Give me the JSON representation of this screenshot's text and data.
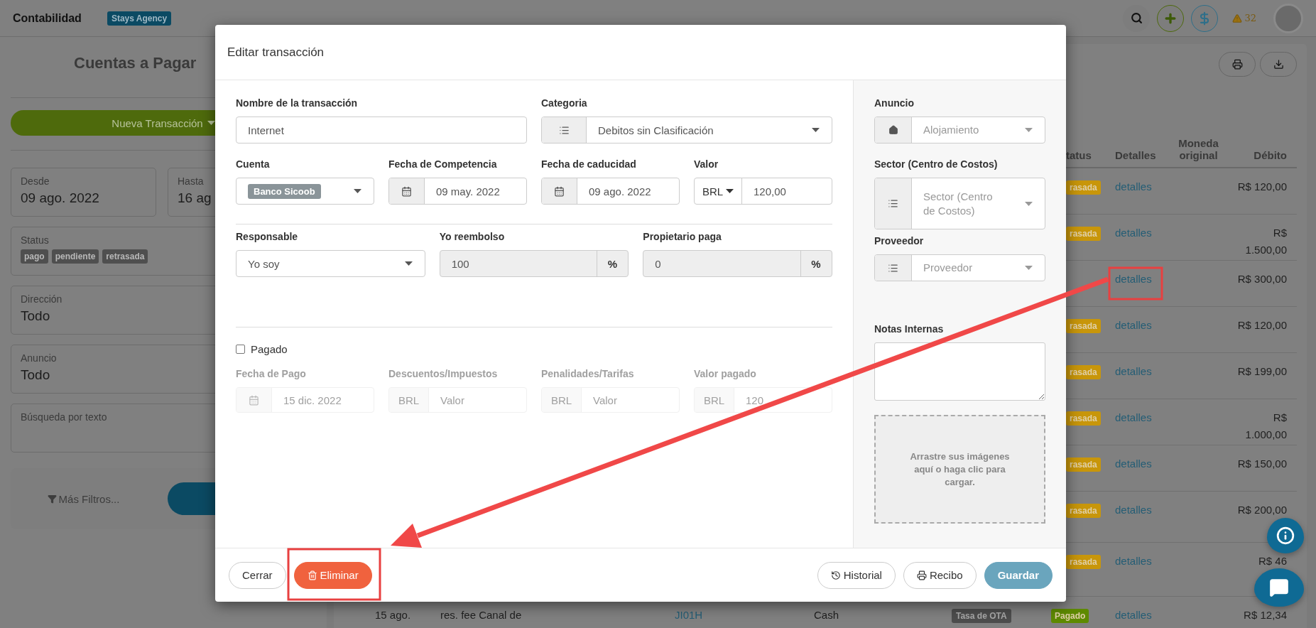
{
  "topbar": {
    "title": "Contabilidad",
    "account_badge": "Stays Agency",
    "alerts": "32"
  },
  "sidebar": {
    "title": "Cuentas a Pagar",
    "new_button": "Nueva Transacción",
    "date_range": [
      {
        "label": "Desde",
        "value": "09 ago. 2022"
      },
      {
        "label": "Hasta",
        "value": "16 ag"
      }
    ],
    "status_filter": {
      "label": "Status",
      "tags": [
        "pago",
        "pendiente",
        "retrasada"
      ]
    },
    "selects": [
      {
        "label": "Dirección",
        "value": "Todo"
      },
      {
        "label": "Anuncio",
        "value": "Todo"
      }
    ],
    "text_search": {
      "label": "Búsqueda por texto"
    },
    "more_filters": "Más Filtros..."
  },
  "table": {
    "columns": [
      {
        "kind": "status",
        "label": "tatus"
      },
      {
        "kind": "details",
        "label": "Detalles"
      },
      {
        "kind": "currency",
        "label": "Moneda original"
      },
      {
        "kind": "debit",
        "label": "Débito"
      }
    ],
    "rows": [
      {
        "kind": "partial",
        "status": {
          "text": "rasada",
          "color": "#c8960a"
        },
        "details": "detalles",
        "debit": "R$ 120,00"
      },
      {
        "kind": "partial",
        "status": {
          "text": "rasada",
          "color": "#c8960a"
        },
        "details": "detalles",
        "debit": "R$ 1.500,00"
      },
      {
        "kind": "partial",
        "details": "detalles",
        "debit": "R$ 300,00"
      },
      {
        "kind": "partial",
        "status": {
          "text": "rasada",
          "color": "#c8960a"
        },
        "details": "detalles",
        "debit": "R$ 120,00"
      },
      {
        "kind": "partial",
        "status": {
          "text": "rasada",
          "color": "#c8960a"
        },
        "details": "detalles",
        "debit": "R$ 199,00"
      },
      {
        "kind": "partial",
        "status": {
          "text": "rasada",
          "color": "#c8960a"
        },
        "details": "detalles",
        "debit": "R$ 1.000,00"
      },
      {
        "kind": "partial",
        "status": {
          "text": "rasada",
          "color": "#c8960a"
        },
        "details": "detalles",
        "debit": "R$ 150,00"
      },
      {
        "kind": "partial",
        "status": {
          "text": "rasada",
          "color": "#c8960a"
        },
        "details": "detalles",
        "debit": "R$ 200,00"
      },
      {
        "kind": "partial",
        "status": {
          "text": "rasada",
          "color": "#c8960a"
        },
        "details": "detalles",
        "debit": "R$ 46"
      },
      {
        "kind": "full",
        "date": "15 ago.",
        "description": "res. fee Canal de",
        "code": "JI01H",
        "method": "Cash",
        "tag": "Tasa de OTA",
        "status": {
          "text": "Pagado",
          "color": "#5e8a00"
        },
        "details": "detalles",
        "debit": "R$ 12,34"
      }
    ]
  },
  "modal": {
    "title": "Editar transacción",
    "name_field": {
      "label": "Nombre de la transacción",
      "value": "Internet"
    },
    "category": {
      "label": "Categoria",
      "value": "Debitos sin Clasificación"
    },
    "account": {
      "label": "Cuenta",
      "value": "Banco Sicoob"
    },
    "competence_date": {
      "label": "Fecha de Competencia",
      "value": "09 may. 2022"
    },
    "due_date": {
      "label": "Fecha de caducidad",
      "value": "09 ago. 2022"
    },
    "amount": {
      "label": "Valor",
      "currency": "BRL",
      "value": "120,00"
    },
    "responsible": {
      "label": "Responsable",
      "value": "Yo soy"
    },
    "shares": [
      {
        "label": "Yo reembolso",
        "value": "100",
        "unit": "%"
      },
      {
        "label": "Propietario paga",
        "value": "0",
        "unit": "%"
      }
    ],
    "paid": {
      "label": "Pagado",
      "checked": false
    },
    "payment": {
      "disabled": true,
      "fields": [
        {
          "kind": "date",
          "label": "Fecha de Pago",
          "value": "15 dic. 2022"
        },
        {
          "kind": "money",
          "label": "Descuentos/Impuestos",
          "currency": "BRL",
          "placeholder": "Valor"
        },
        {
          "kind": "money",
          "label": "Penalidades/Tarifas",
          "currency": "BRL",
          "placeholder": "Valor"
        },
        {
          "kind": "money",
          "label": "Valor pagado",
          "currency": "BRL",
          "value": "120"
        }
      ]
    },
    "listing": {
      "label": "Anuncio",
      "placeholder": "Alojamiento"
    },
    "cost_center": {
      "label": "Sector (Centro de Costos)",
      "placeholder": "Sector (Centro de Costos)"
    },
    "supplier": {
      "label": "Proveedor",
      "placeholder": "Proveedor"
    },
    "notes": {
      "label": "Notas Internas"
    },
    "dropzone": "Arrastre sus imágenes aquí o haga clic para cargar.",
    "buttons": [
      {
        "kind": "close",
        "label": "Cerrar"
      },
      {
        "kind": "delete",
        "label": "Eliminar"
      },
      {
        "kind": "history",
        "label": "Historial"
      },
      {
        "kind": "receipt",
        "label": "Recibo"
      },
      {
        "kind": "save",
        "label": "Guardar"
      }
    ]
  }
}
